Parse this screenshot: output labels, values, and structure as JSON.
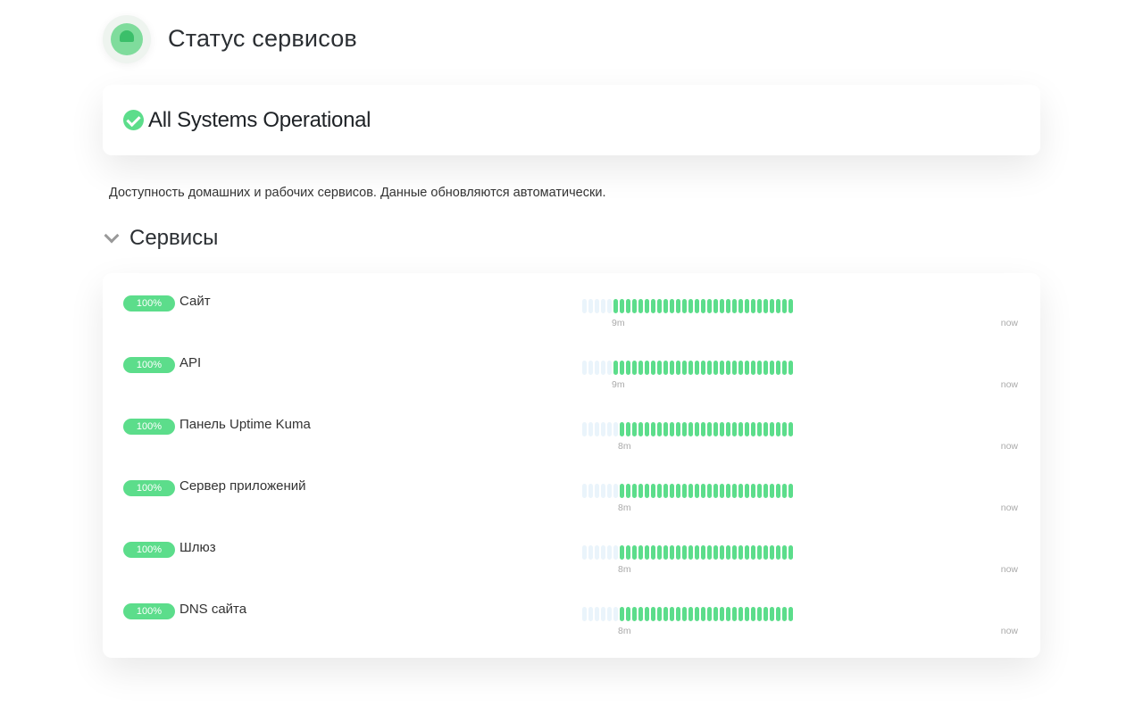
{
  "header": {
    "title": "Статус сервисов",
    "logo_icon": "uptime-kuma-logo"
  },
  "overall_status": {
    "text": "All Systems Operational",
    "icon": "check-circle-icon",
    "color": "#5cdd8b"
  },
  "description": "Доступность домашних и рабочих сервисов. Данные обновляются автоматически.",
  "group": {
    "title": "Сервисы",
    "collapsed": false,
    "monitors": [
      {
        "uptime": "100%",
        "name": "Сайт",
        "beats_total": 34,
        "beats_up": 29,
        "time_start": "9m",
        "time_end": "now"
      },
      {
        "uptime": "100%",
        "name": "API",
        "beats_total": 34,
        "beats_up": 29,
        "time_start": "9m",
        "time_end": "now"
      },
      {
        "uptime": "100%",
        "name": "Панель Uptime Kuma",
        "beats_total": 34,
        "beats_up": 28,
        "time_start": "8m",
        "time_end": "now"
      },
      {
        "uptime": "100%",
        "name": "Сервер приложений",
        "beats_total": 34,
        "beats_up": 28,
        "time_start": "8m",
        "time_end": "now"
      },
      {
        "uptime": "100%",
        "name": "Шлюз",
        "beats_total": 34,
        "beats_up": 28,
        "time_start": "8m",
        "time_end": "now"
      },
      {
        "uptime": "100%",
        "name": "DNS сайта",
        "beats_total": 34,
        "beats_up": 28,
        "time_start": "8m",
        "time_end": "now"
      }
    ]
  },
  "colors": {
    "up": "#5cdd8b",
    "empty": "#eaf4fb"
  }
}
